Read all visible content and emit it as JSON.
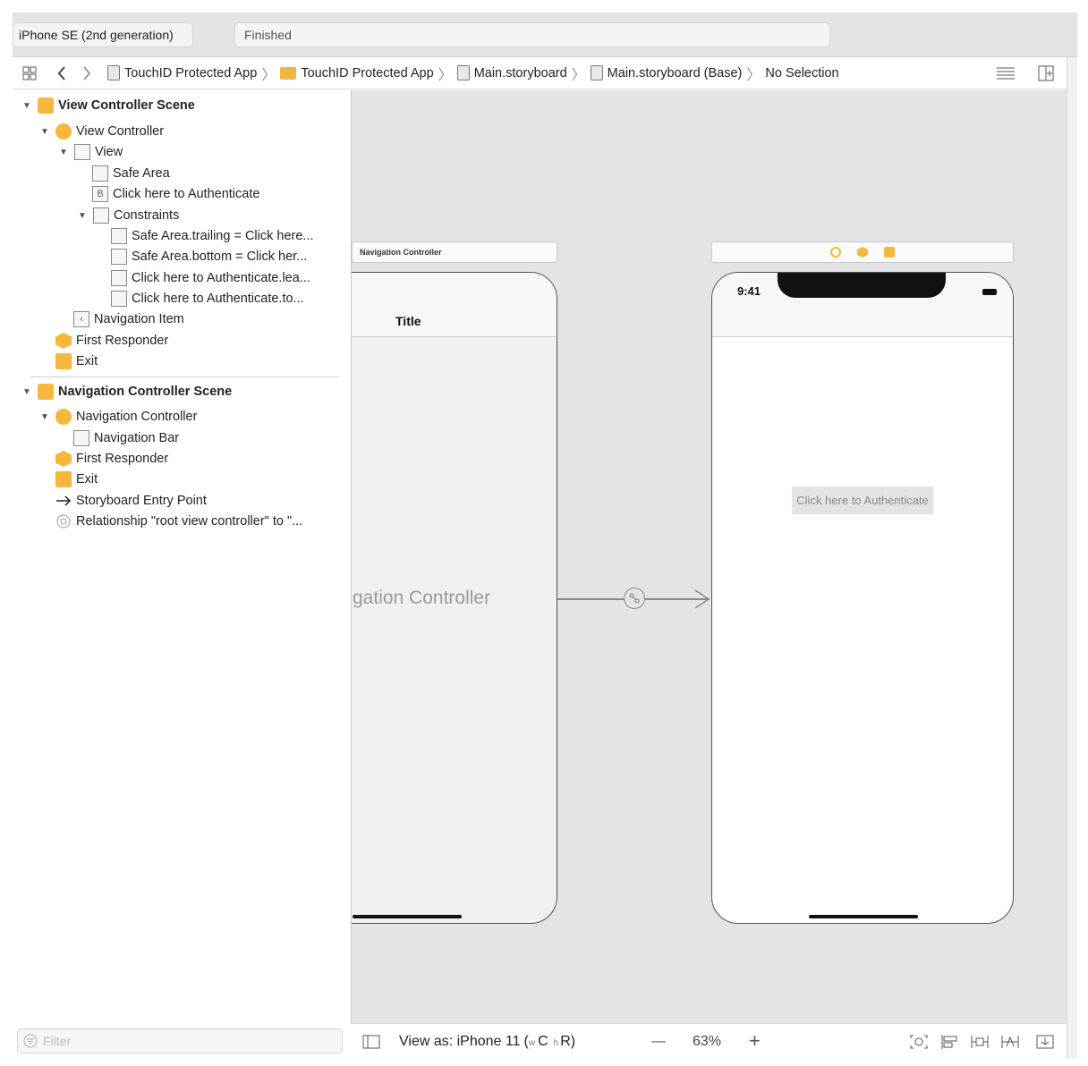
{
  "toolbar": {
    "scheme_device": "iPhone SE (2nd generation)",
    "activity_status": "Finished"
  },
  "jumpbar": {
    "crumbs": [
      {
        "label": "TouchID Protected App",
        "icon": "project-file-icon"
      },
      {
        "label": "TouchID Protected App",
        "icon": "folder-icon"
      },
      {
        "label": "Main.storyboard",
        "icon": "storyboard-file-icon"
      },
      {
        "label": "Main.storyboard (Base)",
        "icon": "storyboard-file-icon"
      },
      {
        "label": "No Selection",
        "icon": ""
      }
    ]
  },
  "outline": {
    "vc_scene": "View Controller Scene",
    "view_controller": "View Controller",
    "view": "View",
    "safe_area": "Safe Area",
    "button": "Click here to Authenticate",
    "constraints": "Constraints",
    "c1": "Safe Area.trailing = Click here...",
    "c2": "Safe Area.bottom = Click her...",
    "c3": "Click here to Authenticate.lea...",
    "c4": "Click here to Authenticate.to...",
    "nav_item": "Navigation Item",
    "first_responder": "First Responder",
    "exit": "Exit",
    "nav_scene": "Navigation Controller Scene",
    "nav_controller": "Navigation Controller",
    "nav_bar": "Navigation Bar",
    "first_responder_2": "First Responder",
    "exit_2": "Exit",
    "entry_point": "Storyboard Entry Point",
    "relationship": "Relationship \"root view controller\" to \"..."
  },
  "filter": {
    "placeholder": "Filter"
  },
  "canvas": {
    "nav_scene_label": "Navigation Controller",
    "nav_title": "Title",
    "nav_placeholder": "gation Controller",
    "vc_time": "9:41",
    "auth_button": "Click here to Authenticate"
  },
  "bottombar": {
    "view_as": "View as: iPhone 11",
    "size_class_w": "w",
    "size_class_c": "C",
    "size_class_h": "h",
    "size_class_r": "R",
    "zoom_minus": "—",
    "zoom": "63%",
    "zoom_plus": "+"
  },
  "colors": {
    "accent": "#f6b73c",
    "canvas_bg": "#e4e4e7"
  }
}
